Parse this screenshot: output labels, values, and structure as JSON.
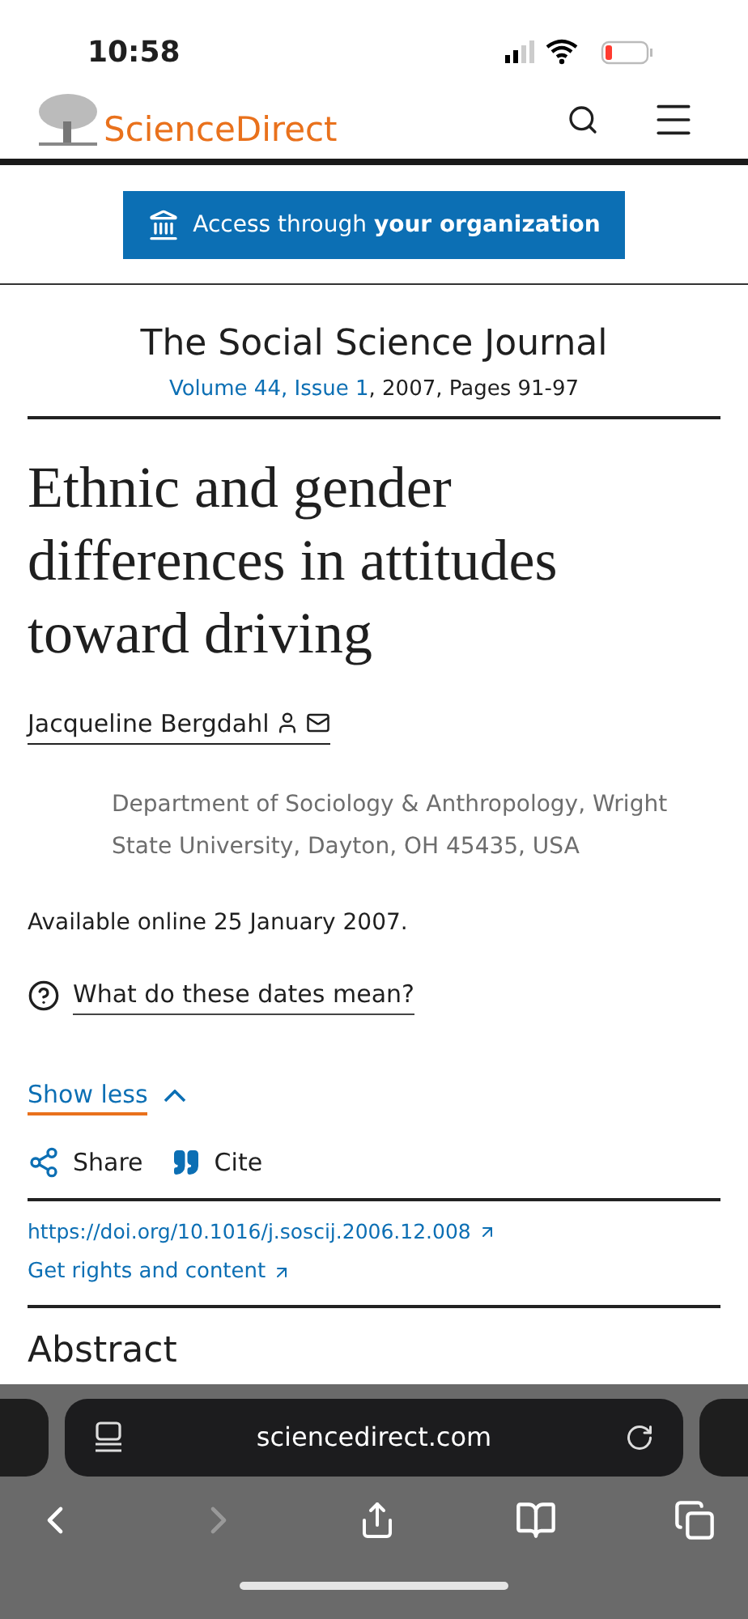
{
  "status_bar": {
    "time": "10:58"
  },
  "header": {
    "logo_text": "ScienceDirect"
  },
  "access_button": {
    "label": "Access through **your organization**"
  },
  "journal": {
    "title": "The Social Science Journal",
    "issue_link": "Volume 44, Issue 1",
    "pages": ", 2007, Pages 91-97"
  },
  "article": {
    "title": "Ethnic and gender differences in attitudes toward driving",
    "author": "Jacqueline Bergdahl",
    "affiliation": "Department of Sociology & Anthropology, Wright State University, Dayton, OH 45435, USA",
    "available": "Available online 25 January 2007.",
    "dates_link": "What do these dates mean?",
    "toggle": {
      "label": "Show less",
      "expanded": true
    },
    "actions": [
      "Share",
      "Cite"
    ],
    "doi": "https://doi.org/10.1016/j.soscij.2006.12.008",
    "rights": "Get rights and content",
    "next_heading": "Abstract"
  },
  "browser": {
    "url": "sciencedirect.com"
  }
}
